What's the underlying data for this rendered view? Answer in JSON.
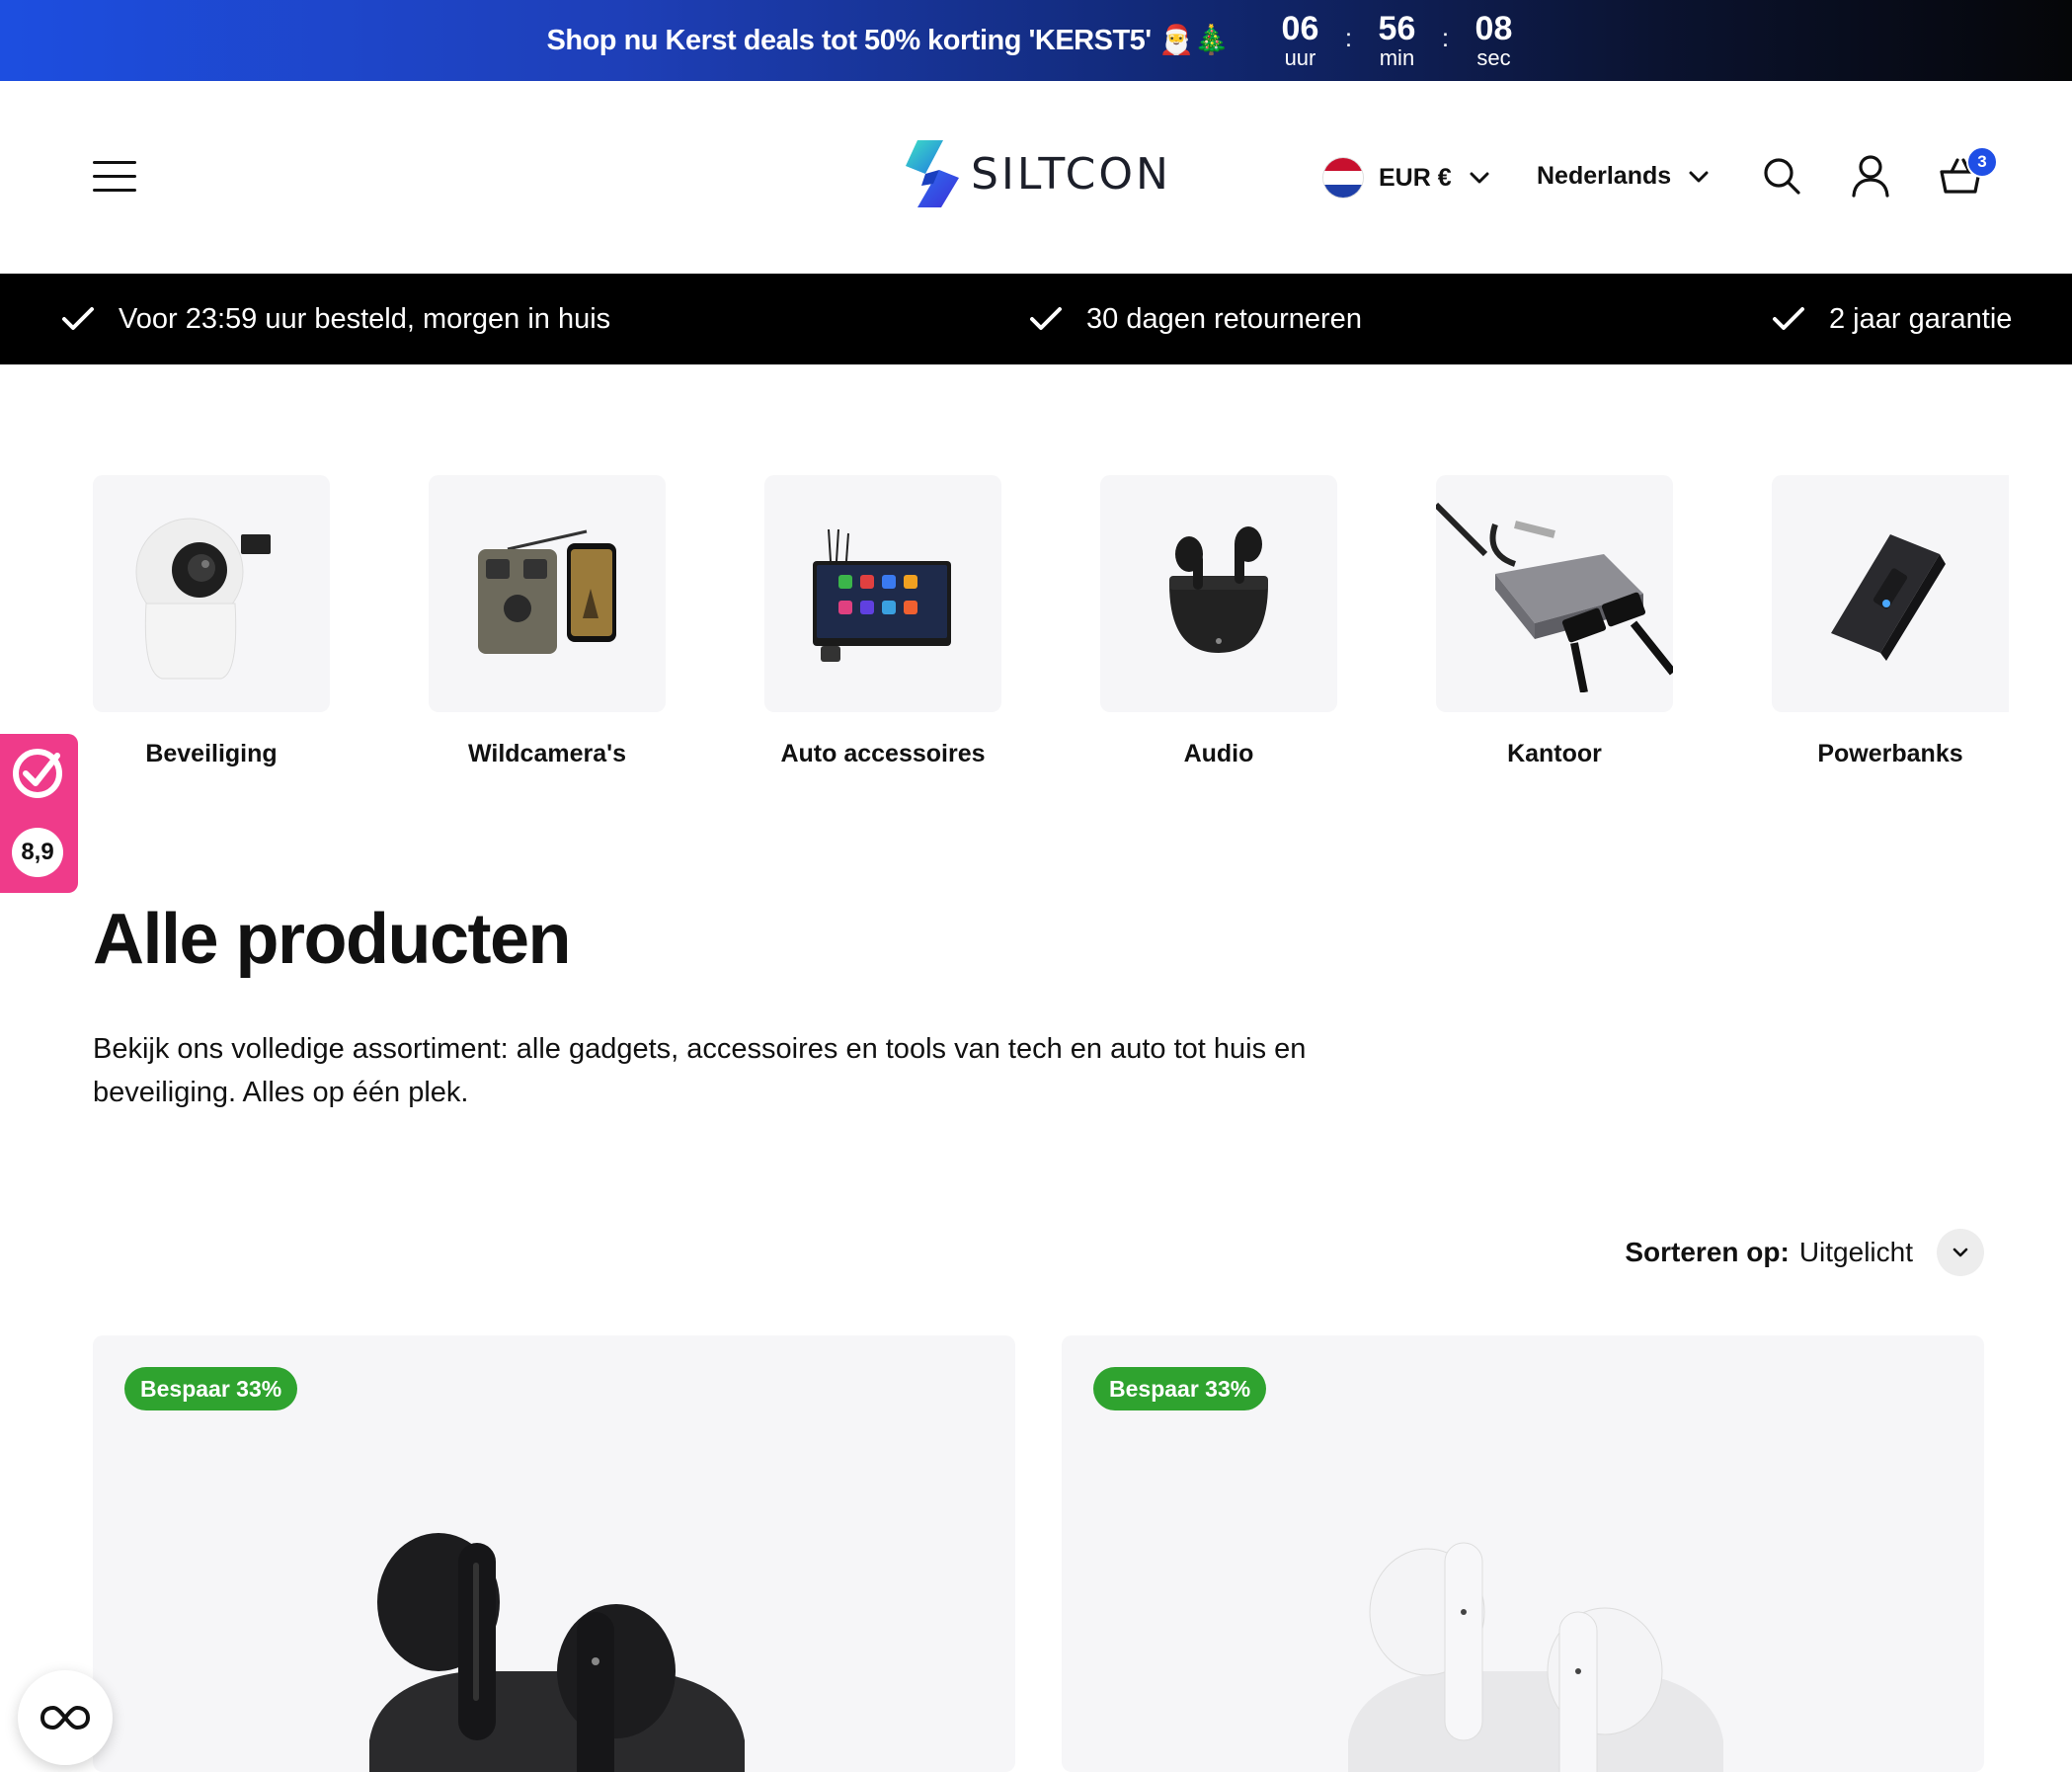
{
  "promo": {
    "text": "Shop nu Kerst deals tot 50% korting 'KERST5' 🎅🎄",
    "countdown": {
      "hours": "06",
      "hours_label": "uur",
      "minutes": "56",
      "minutes_label": "min",
      "seconds": "08",
      "seconds_label": "sec",
      "separator": ":"
    }
  },
  "header": {
    "logo_text": "SILTCON",
    "currency": "EUR €",
    "language": "Nederlands",
    "cart_count": "3"
  },
  "usp": {
    "items": [
      {
        "label": "Voor 23:59 uur besteld, morgen in huis"
      },
      {
        "label": "30 dagen retourneren"
      },
      {
        "label": "2 jaar garantie"
      }
    ]
  },
  "categories": [
    {
      "label": "Beveiliging",
      "icon": "security-camera-icon"
    },
    {
      "label": "Wildcamera's",
      "icon": "wildcamera-icon"
    },
    {
      "label": "Auto accessoires",
      "icon": "car-display-icon"
    },
    {
      "label": "Audio",
      "icon": "earbuds-icon"
    },
    {
      "label": "Kantoor",
      "icon": "usb-hub-icon"
    },
    {
      "label": "Powerbanks",
      "icon": "powerbank-icon"
    }
  ],
  "rating": {
    "score": "8,9"
  },
  "main": {
    "title": "Alle producten",
    "description": "Bekijk ons volledige assortiment: alle gadgets, accessoires en tools van tech en auto tot huis en beveiliging. Alles op één plek."
  },
  "sort": {
    "label": "Sorteren op:",
    "value": "Uitgelicht"
  },
  "products": [
    {
      "badge": "Bespaar 33%",
      "color": "#1a1a1a"
    },
    {
      "badge": "Bespaar 33%",
      "color": "#f2f2f2"
    }
  ],
  "colors": {
    "promo_start": "#1d4ee0",
    "promo_end": "#050608",
    "usp_bg": "#000000",
    "badge_green": "#2fa32f",
    "rating_pink": "#ef3b8a",
    "cart_badge": "#1f4fe6"
  }
}
